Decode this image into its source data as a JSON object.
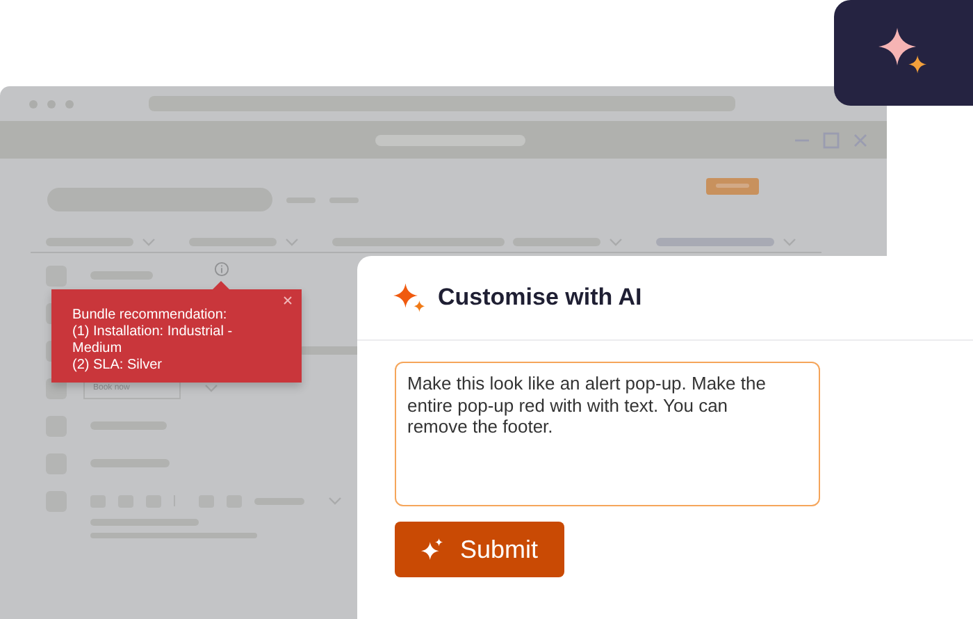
{
  "background_app": {
    "booking_field": {
      "placeholder": "Book now"
    }
  },
  "tooltip": {
    "lines": [
      "Bundle recommendation:",
      "(1) Installation: Industrial - Medium",
      "(2) SLA: Silver"
    ]
  },
  "ai_panel": {
    "title": "Customise with AI",
    "prompt": {
      "value": "Make this look like an alert pop-up. Make the entire pop-up red with with text. You can remove the footer."
    },
    "submit_button": {
      "label": "Submit"
    }
  }
}
